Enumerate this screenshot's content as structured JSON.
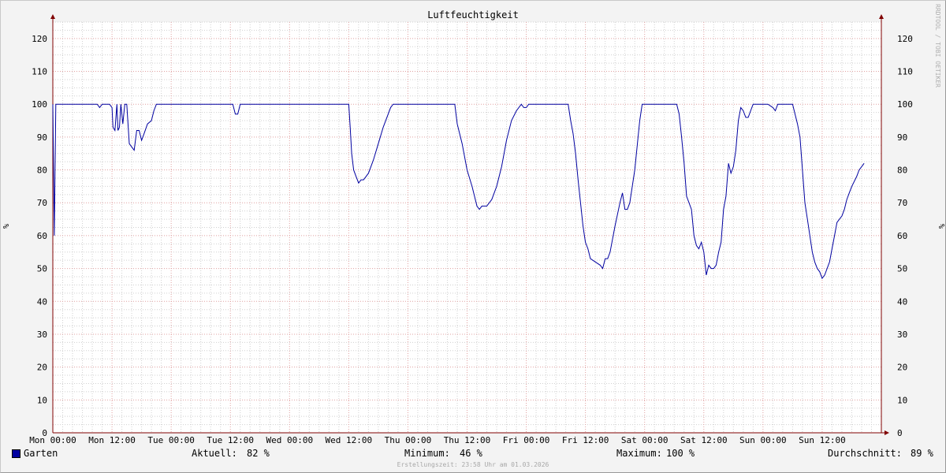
{
  "window": {
    "title": "Luftfeuchtigkeit",
    "watermark": "RRDTOOL / TOBI OETIKER"
  },
  "legend": {
    "series_name": "Garten",
    "current_label": "Aktuell:",
    "current_value": "82 %",
    "min_label": "Minimum:",
    "min_value": "46 %",
    "max_label": "Maximum:",
    "max_value": "100 %",
    "avg_label": "Durchschnitt:",
    "avg_value": "89 %"
  },
  "footer": "Erstellungszeit: 23:58 Uhr am 01.03.2026",
  "colors": {
    "series": "#0000a0",
    "major_grid": "#e0a0a0",
    "minor_grid": "#d0d0d0",
    "axis": "#800000"
  },
  "chart_data": {
    "type": "line",
    "title": "Luftfeuchtigkeit",
    "ylabel": "%",
    "xlim": [
      0,
      168
    ],
    "ylim": [
      0,
      125
    ],
    "grid": true,
    "y_ticks": [
      0,
      10,
      20,
      30,
      40,
      50,
      60,
      70,
      80,
      90,
      100,
      110,
      120
    ],
    "x_ticks": [
      {
        "t": 0,
        "label": "Mon 00:00"
      },
      {
        "t": 12,
        "label": "Mon 12:00"
      },
      {
        "t": 24,
        "label": "Tue 00:00"
      },
      {
        "t": 36,
        "label": "Tue 12:00"
      },
      {
        "t": 48,
        "label": "Wed 00:00"
      },
      {
        "t": 60,
        "label": "Wed 12:00"
      },
      {
        "t": 72,
        "label": "Thu 00:00"
      },
      {
        "t": 84,
        "label": "Thu 12:00"
      },
      {
        "t": 96,
        "label": "Fri 00:00"
      },
      {
        "t": 108,
        "label": "Fri 12:00"
      },
      {
        "t": 120,
        "label": "Sat 00:00"
      },
      {
        "t": 132,
        "label": "Sat 12:00"
      },
      {
        "t": 144,
        "label": "Sun 00:00"
      },
      {
        "t": 156,
        "label": "Sun 12:00"
      }
    ],
    "series": [
      {
        "name": "Garten",
        "points": [
          [
            0.0,
            100
          ],
          [
            0.3,
            60
          ],
          [
            0.6,
            100
          ],
          [
            9.0,
            100
          ],
          [
            9.5,
            99
          ],
          [
            10.0,
            100
          ],
          [
            11.5,
            100
          ],
          [
            12.0,
            99
          ],
          [
            12.2,
            93
          ],
          [
            12.6,
            92
          ],
          [
            13.0,
            100
          ],
          [
            13.2,
            92
          ],
          [
            13.5,
            93
          ],
          [
            13.8,
            100
          ],
          [
            14.2,
            94
          ],
          [
            14.6,
            100
          ],
          [
            15.0,
            100
          ],
          [
            15.5,
            88
          ],
          [
            16.0,
            87
          ],
          [
            16.5,
            86
          ],
          [
            17.0,
            92
          ],
          [
            17.5,
            92
          ],
          [
            18.0,
            89
          ],
          [
            18.5,
            91
          ],
          [
            19.2,
            94
          ],
          [
            20.0,
            95
          ],
          [
            20.5,
            98
          ],
          [
            21.0,
            100
          ],
          [
            36.5,
            100
          ],
          [
            37.0,
            97
          ],
          [
            37.5,
            97
          ],
          [
            38.0,
            100
          ],
          [
            60.0,
            100
          ],
          [
            60.3,
            93
          ],
          [
            60.6,
            85
          ],
          [
            61.0,
            80
          ],
          [
            61.5,
            78
          ],
          [
            62.0,
            76
          ],
          [
            62.5,
            77
          ],
          [
            63.0,
            77
          ],
          [
            63.5,
            78
          ],
          [
            64.0,
            79
          ],
          [
            65.0,
            83
          ],
          [
            66.0,
            88
          ],
          [
            67.0,
            93
          ],
          [
            68.0,
            97
          ],
          [
            68.5,
            99
          ],
          [
            69.0,
            100
          ],
          [
            81.5,
            100
          ],
          [
            82.0,
            94
          ],
          [
            82.5,
            91
          ],
          [
            83.0,
            88
          ],
          [
            84.0,
            80
          ],
          [
            85.0,
            75
          ],
          [
            85.5,
            72
          ],
          [
            86.0,
            69
          ],
          [
            86.5,
            68
          ],
          [
            87.0,
            69
          ],
          [
            88.0,
            69
          ],
          [
            89.0,
            71
          ],
          [
            90.0,
            75
          ],
          [
            91.0,
            81
          ],
          [
            92.0,
            89
          ],
          [
            93.0,
            95
          ],
          [
            94.0,
            98
          ],
          [
            95.0,
            100
          ],
          [
            95.5,
            99
          ],
          [
            96.0,
            99
          ],
          [
            96.5,
            100
          ],
          [
            104.5,
            100
          ],
          [
            105.0,
            95
          ],
          [
            105.5,
            91
          ],
          [
            106.0,
            85
          ],
          [
            106.5,
            77
          ],
          [
            107.0,
            70
          ],
          [
            107.5,
            63
          ],
          [
            108.0,
            58
          ],
          [
            108.5,
            56
          ],
          [
            109.0,
            53
          ],
          [
            110.0,
            52
          ],
          [
            111.0,
            51
          ],
          [
            111.5,
            50
          ],
          [
            112.0,
            53
          ],
          [
            112.5,
            53
          ],
          [
            113.0,
            55
          ],
          [
            114.0,
            63
          ],
          [
            115.0,
            70
          ],
          [
            115.5,
            73
          ],
          [
            116.0,
            68
          ],
          [
            116.5,
            68
          ],
          [
            117.0,
            70
          ],
          [
            118.0,
            80
          ],
          [
            119.0,
            95
          ],
          [
            119.5,
            100
          ],
          [
            126.5,
            100
          ],
          [
            127.0,
            97
          ],
          [
            127.5,
            90
          ],
          [
            128.0,
            82
          ],
          [
            128.5,
            72
          ],
          [
            129.0,
            70
          ],
          [
            129.5,
            68
          ],
          [
            130.0,
            60
          ],
          [
            130.5,
            57
          ],
          [
            131.0,
            56
          ],
          [
            131.5,
            58
          ],
          [
            132.0,
            55
          ],
          [
            132.5,
            48
          ],
          [
            133.0,
            51
          ],
          [
            133.5,
            50
          ],
          [
            134.0,
            50
          ],
          [
            134.5,
            51
          ],
          [
            135.0,
            55
          ],
          [
            135.5,
            58
          ],
          [
            136.0,
            68
          ],
          [
            136.5,
            72
          ],
          [
            137.0,
            82
          ],
          [
            137.5,
            79
          ],
          [
            138.0,
            81
          ],
          [
            138.5,
            86
          ],
          [
            139.0,
            95
          ],
          [
            139.5,
            99
          ],
          [
            140.0,
            98
          ],
          [
            140.5,
            96
          ],
          [
            141.0,
            96
          ],
          [
            141.5,
            98
          ],
          [
            142.0,
            100
          ],
          [
            145.0,
            100
          ],
          [
            146.0,
            99
          ],
          [
            146.5,
            98
          ],
          [
            147.0,
            100
          ],
          [
            150.0,
            100
          ],
          [
            151.0,
            94
          ],
          [
            151.5,
            90
          ],
          [
            152.0,
            80
          ],
          [
            152.5,
            70
          ],
          [
            153.0,
            65
          ],
          [
            153.5,
            60
          ],
          [
            154.0,
            55
          ],
          [
            154.5,
            52
          ],
          [
            155.0,
            50
          ],
          [
            155.5,
            49
          ],
          [
            156.0,
            47
          ],
          [
            156.5,
            48
          ],
          [
            157.0,
            50
          ],
          [
            157.5,
            52
          ],
          [
            158.0,
            56
          ],
          [
            158.5,
            60
          ],
          [
            159.0,
            64
          ],
          [
            159.5,
            65
          ],
          [
            160.0,
            66
          ],
          [
            160.5,
            68
          ],
          [
            161.0,
            71
          ],
          [
            161.5,
            73
          ],
          [
            162.0,
            75
          ],
          [
            163.0,
            78
          ],
          [
            163.5,
            80
          ],
          [
            164.0,
            81
          ],
          [
            164.5,
            82
          ]
        ]
      }
    ]
  }
}
